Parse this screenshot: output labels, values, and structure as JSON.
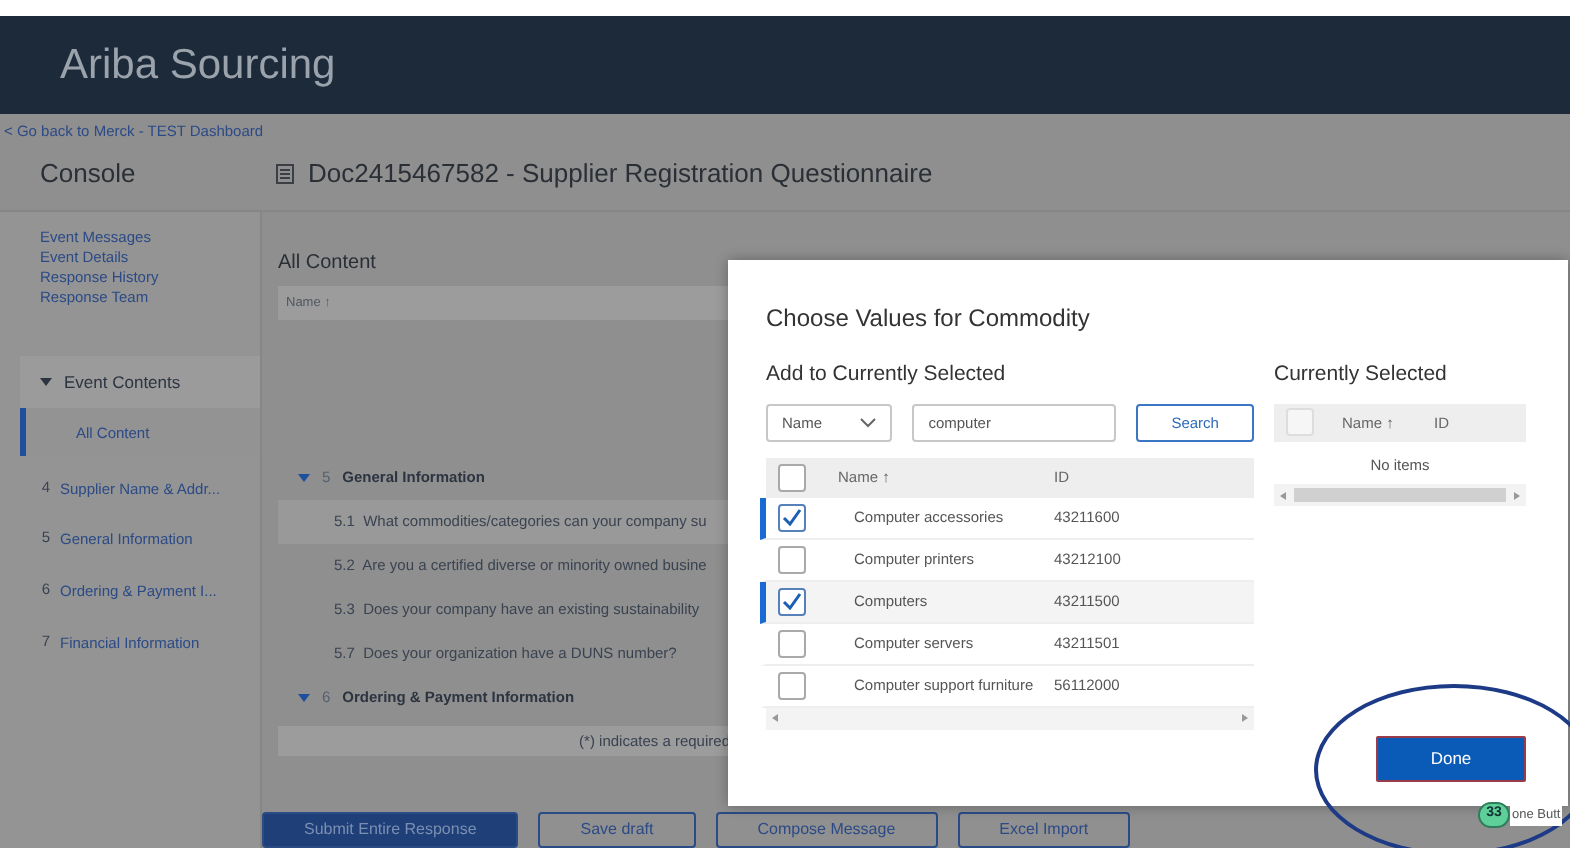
{
  "header": {
    "title": "Ariba Sourcing"
  },
  "back_link": "< Go back to Merck - TEST Dashboard",
  "console_title": "Console",
  "document_title": "Doc2415467582 - Supplier Registration Questionnaire",
  "sidebar": {
    "links": [
      "Event Messages",
      "Event Details",
      "Response History",
      "Response Team"
    ],
    "section": {
      "label": "Event Contents",
      "expanded": true
    },
    "items": [
      {
        "label": "All Content",
        "selected": true
      },
      {
        "number": "4",
        "label": "Supplier Name & Addr...",
        "selected": false
      },
      {
        "number": "5",
        "label": "General Information",
        "selected": false
      },
      {
        "number": "6",
        "label": "Ordering & Payment I...",
        "selected": false
      },
      {
        "number": "7",
        "label": "Financial Information",
        "selected": false
      }
    ]
  },
  "content": {
    "heading": "All Content",
    "column": "Name ↑",
    "sections": [
      {
        "number": "5",
        "title": "General Information",
        "expanded": true,
        "children": [
          {
            "number": "5.1",
            "text": "What commodities/categories can your company su",
            "selected": true
          },
          {
            "number": "5.2",
            "text": "Are you a certified diverse or minority owned busine",
            "selected": false
          },
          {
            "number": "5.3",
            "text": "Does your company have an existing sustainability",
            "selected": false
          },
          {
            "number": "5.7",
            "text": "Does your organization have a DUNS number?",
            "selected": false
          }
        ]
      },
      {
        "number": "6",
        "title": "Ordering & Payment Information",
        "expanded": true
      }
    ],
    "note": "(*) indicates a required"
  },
  "page_buttons": [
    {
      "label": "Submit Entire Response",
      "kind": "primary"
    },
    {
      "label": "Save draft",
      "kind": "secondary"
    },
    {
      "label": "Compose Message",
      "kind": "secondary"
    },
    {
      "label": "Excel Import",
      "kind": "secondary"
    }
  ],
  "dialog": {
    "title": "Choose Values for Commodity",
    "left_heading": "Add to Currently Selected",
    "search_by": "Name",
    "search_value": "computer",
    "search_button": "Search",
    "columns": [
      "Name ↑",
      "ID"
    ],
    "select_all_checked": false,
    "rows": [
      {
        "name": "Computer accessories",
        "id": "43211600",
        "checked": true
      },
      {
        "name": "Computer printers",
        "id": "43212100",
        "checked": false
      },
      {
        "name": "Computers",
        "id": "43211500",
        "checked": true
      },
      {
        "name": "Computer servers",
        "id": "43211501",
        "checked": false
      },
      {
        "name": "Computer support furniture",
        "id": "56112000",
        "checked": false
      }
    ],
    "right_heading": "Currently Selected",
    "right_columns": [
      "Name ↑",
      "ID"
    ],
    "right_select_all_checked": false,
    "empty_text": "No items",
    "done_button": "Done"
  },
  "annotation": {
    "badge": "33",
    "tooltip": "one Butt"
  }
}
